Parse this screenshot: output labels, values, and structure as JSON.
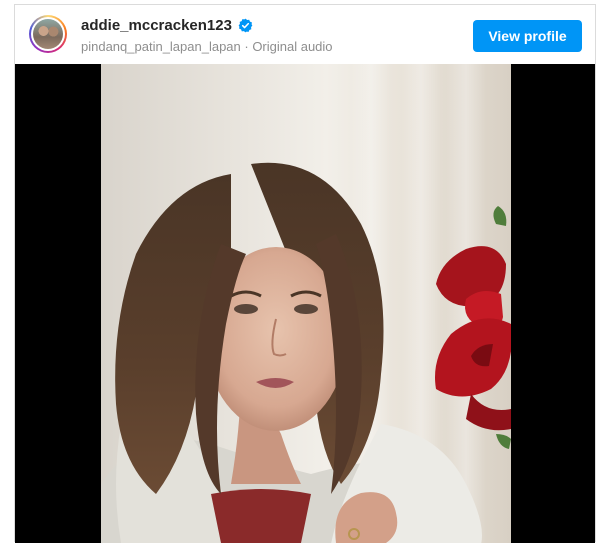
{
  "post": {
    "username": "addie_mccracken123",
    "audio_line": "pindanq_patin_lapan_lapan · Original audio",
    "verified_icon": "verified-badge-icon",
    "view_profile_label": "View profile"
  },
  "colors": {
    "accent": "#0095f6",
    "username": "#262626",
    "secondary_text": "#8e8e8e",
    "letterbox": "#000000"
  }
}
